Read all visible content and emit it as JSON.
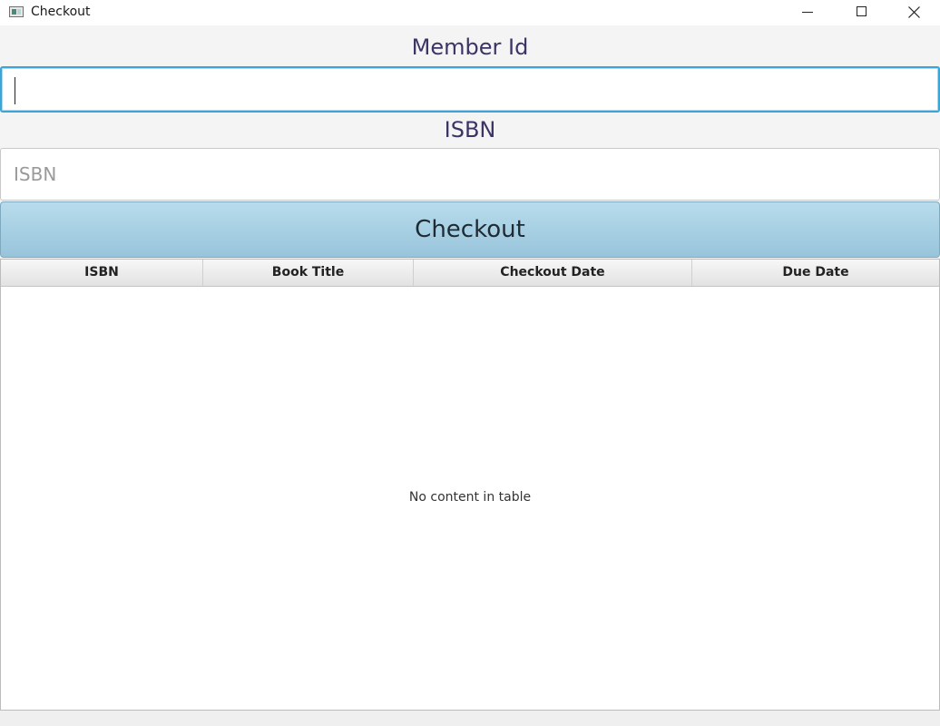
{
  "window": {
    "title": "Checkout",
    "icons": [
      "app-icon",
      "minimize-icon",
      "maximize-icon",
      "close-icon"
    ]
  },
  "form": {
    "member_label": "Member Id",
    "member_value": "",
    "isbn_label": "ISBN",
    "isbn_placeholder": "ISBN",
    "isbn_value": "",
    "checkout_button": "Checkout"
  },
  "table": {
    "columns": [
      "ISBN",
      "Book Title",
      "Checkout Date",
      "Due Date"
    ],
    "rows": [],
    "empty_message": "No content in table"
  },
  "colors": {
    "label_text": "#3b3566",
    "focus_border": "#3aa5d8",
    "button_top": "#b8dcec",
    "button_bottom": "#98c4db"
  }
}
